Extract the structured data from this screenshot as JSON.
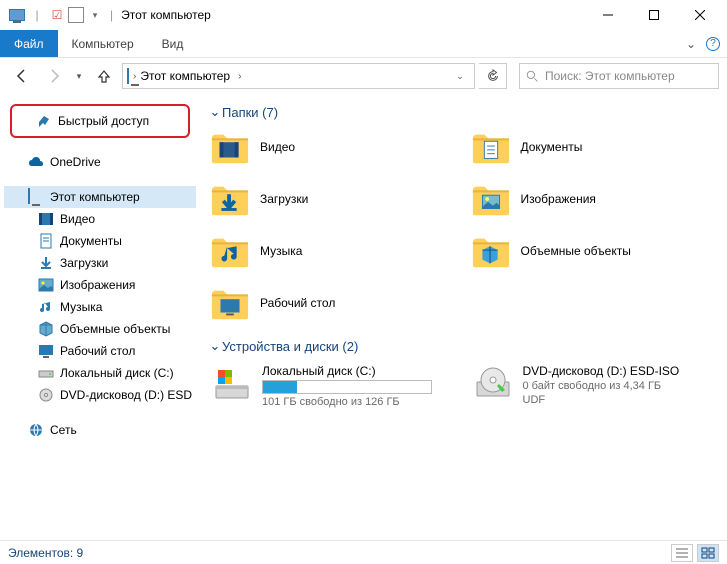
{
  "window": {
    "title": "Этот компьютер",
    "min": "—",
    "max": "☐",
    "close": "✕"
  },
  "ribbon": {
    "file": "Файл",
    "computer": "Компьютер",
    "view": "Вид"
  },
  "nav": {
    "address": "Этот компьютер",
    "search_placeholder": "Поиск: Этот компьютер"
  },
  "sidebar": {
    "quick": "Быстрый доступ",
    "onedrive": "OneDrive",
    "thispc": "Этот компьютер",
    "items": [
      "Видео",
      "Документы",
      "Загрузки",
      "Изображения",
      "Музыка",
      "Объемные объекты",
      "Рабочий стол",
      "Локальный диск (C:)",
      "DVD-дисковод (D:) ESD"
    ],
    "network": "Сеть"
  },
  "groups": {
    "folders_label": "Папки (7)",
    "devices_label": "Устройства и диски (2)"
  },
  "folders": [
    {
      "name": "Видео",
      "icon": "video"
    },
    {
      "name": "Документы",
      "icon": "docs"
    },
    {
      "name": "Загрузки",
      "icon": "downloads"
    },
    {
      "name": "Изображения",
      "icon": "pictures"
    },
    {
      "name": "Музыка",
      "icon": "music"
    },
    {
      "name": "Объемные объекты",
      "icon": "3d"
    },
    {
      "name": "Рабочий стол",
      "icon": "desktop"
    }
  ],
  "disks": [
    {
      "name": "Локальный диск (C:)",
      "sub": "101 ГБ свободно из 126 ГБ",
      "pct": 20,
      "type": "hdd"
    },
    {
      "name": "DVD-дисковод (D:) ESD-ISO",
      "sub": "0 байт свободно из 4,34 ГБ",
      "sub2": "UDF",
      "type": "dvd"
    }
  ],
  "status": {
    "count_label": "Элементов: 9"
  }
}
